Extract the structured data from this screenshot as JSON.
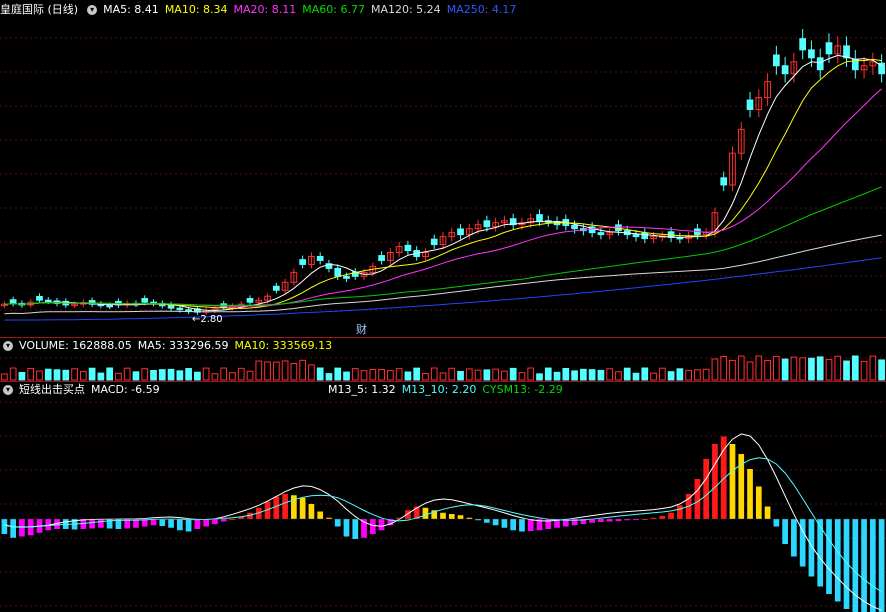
{
  "colors": {
    "up": "#ff3030",
    "down": "#54ffff",
    "bg": "#000000",
    "grid": "#5a0f14",
    "ma5": "#ffffff",
    "ma10": "#ffff00",
    "ma20": "#ff33ff",
    "ma60": "#00cc00",
    "ma120": "#d9d9d9",
    "ma250": "#2244ff",
    "macd_red": "#ff1a1a",
    "macd_yellow": "#ffd800",
    "macd_cyan": "#2cd8ff",
    "macd_mag": "#ff00ff"
  },
  "main": {
    "stock_name": "皇庭国际 (日线)",
    "ma5": "MA5: 8.41",
    "ma10": "MA10: 8.34",
    "ma20": "MA20: 8.11",
    "ma60": "MA60: 6.77",
    "ma120": "MA120: 5.24",
    "ma250": "MA250: 4.17",
    "low_marker": "←2.80",
    "fin_marker": "财"
  },
  "volume": {
    "label": "VOLUME: 162888.05",
    "ma5": "MA5: 333296.59",
    "ma10": "MA10: 333569.13"
  },
  "indicator": {
    "name": "短线出击买点",
    "macd": "MACD: -6.59",
    "m13_5": "M13_5: 1.32",
    "m13_10": "M13_10: 2.20",
    "cysm13": "CYSM13: -2.29"
  },
  "chart_data": {
    "type": "candlestick",
    "price_low_marked": 2.8,
    "closes": [
      3.0,
      3.02,
      2.98,
      3.05,
      3.1,
      3.08,
      3.02,
      2.98,
      3.0,
      3.04,
      3.0,
      2.97,
      2.95,
      2.98,
      3.02,
      3.0,
      3.05,
      3.02,
      2.96,
      2.9,
      2.86,
      2.82,
      2.8,
      2.85,
      2.88,
      2.92,
      2.95,
      3.0,
      3.05,
      3.1,
      3.2,
      3.35,
      3.55,
      3.8,
      4.0,
      4.2,
      4.1,
      3.9,
      3.7,
      3.65,
      3.7,
      3.8,
      3.95,
      4.1,
      4.3,
      4.45,
      4.35,
      4.2,
      4.3,
      4.5,
      4.7,
      4.8,
      4.75,
      4.9,
      5.0,
      4.95,
      5.05,
      5.1,
      5.0,
      5.05,
      5.15,
      5.1,
      5.08,
      5.0,
      4.98,
      4.9,
      4.85,
      4.8,
      4.75,
      4.8,
      4.85,
      4.75,
      4.7,
      4.65,
      4.7,
      4.72,
      4.68,
      4.65,
      4.7,
      4.75,
      4.8,
      5.3,
      6.0,
      6.8,
      7.4,
      7.9,
      8.2,
      8.6,
      9.0,
      8.8,
      9.1,
      9.4,
      9.2,
      8.9,
      9.3,
      9.5,
      9.2,
      8.9,
      9.0,
      9.1,
      8.8
    ],
    "macd_hist": [
      -0.6,
      -0.75,
      -0.7,
      -0.65,
      -0.55,
      -0.45,
      -0.4,
      -0.4,
      -0.42,
      -0.4,
      -0.38,
      -0.35,
      -0.38,
      -0.4,
      -0.38,
      -0.35,
      -0.3,
      -0.25,
      -0.28,
      -0.35,
      -0.45,
      -0.5,
      -0.4,
      -0.3,
      -0.2,
      -0.1,
      0.0,
      0.1,
      0.25,
      0.45,
      0.7,
      0.9,
      1.0,
      0.95,
      0.85,
      0.6,
      0.3,
      0.05,
      -0.3,
      -0.7,
      -0.8,
      -0.75,
      -0.6,
      -0.45,
      -0.25,
      0.05,
      0.35,
      0.5,
      0.45,
      0.35,
      0.25,
      0.2,
      0.15,
      0.05,
      -0.05,
      -0.15,
      -0.25,
      -0.35,
      -0.45,
      -0.5,
      -0.48,
      -0.45,
      -0.4,
      -0.35,
      -0.3,
      -0.25,
      -0.2,
      -0.15,
      -0.12,
      -0.1,
      -0.08,
      -0.05,
      -0.03,
      0.0,
      0.05,
      0.12,
      0.25,
      0.55,
      1.0,
      1.6,
      2.4,
      3.0,
      3.3,
      3.0,
      2.6,
      2.0,
      1.3,
      0.5,
      -0.3,
      -1.0,
      -1.5,
      -1.9,
      -2.3,
      -2.7,
      -3.0,
      -3.3,
      -3.6,
      -3.8,
      -3.9,
      -4.0,
      -4.0
    ]
  }
}
